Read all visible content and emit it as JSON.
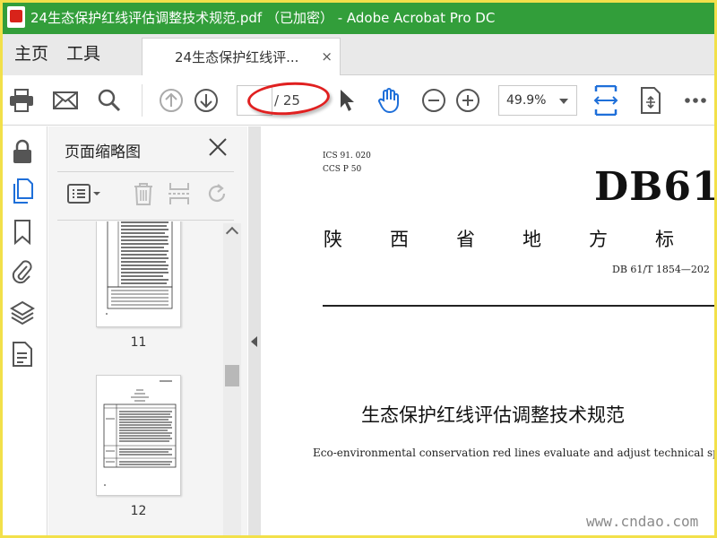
{
  "window": {
    "title": "24生态保护红线评估调整技术规范.pdf （已加密） - Adobe Acrobat Pro DC"
  },
  "menu": {
    "home": "主页",
    "tools": "工具"
  },
  "tab": {
    "label": "24生态保护红线评...",
    "close": "×"
  },
  "toolbar": {
    "page_current": "",
    "page_total": "/ 25",
    "zoom_value": "49.9%"
  },
  "thumbnail_panel": {
    "title": "页面缩略图",
    "pages": [
      {
        "number": "11"
      },
      {
        "number": "12"
      }
    ]
  },
  "document": {
    "ics": "ICS 91. 020",
    "ccs": "CCS P 50",
    "header_code": "DB61",
    "standard_chars": [
      "陕",
      "西",
      "省",
      "地",
      "方",
      "标"
    ],
    "standard_code": "DB 61/T 1854—202",
    "title_cn": "生态保护红线评估调整技术规范",
    "title_en": "Eco-environmental conservation red lines evaluate and adjust technical specification"
  },
  "watermark": "www.cndao.com",
  "colors": {
    "titlebar": "#329e3a",
    "frame": "#f2e04a",
    "accent_blue": "#1e6fd9",
    "annotation_red": "#e02020"
  }
}
